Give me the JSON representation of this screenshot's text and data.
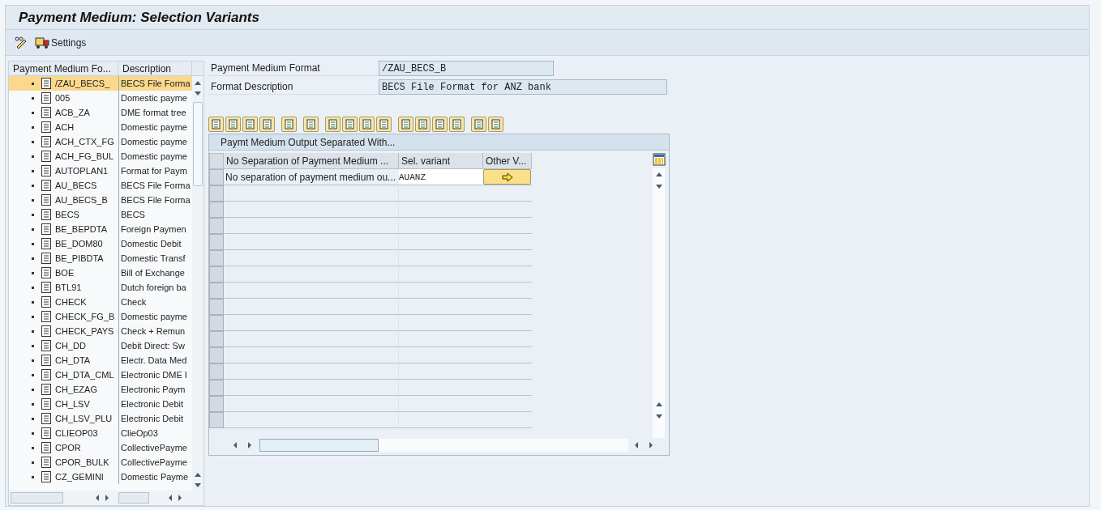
{
  "window": {
    "title": "Payment Medium: Selection Variants"
  },
  "toolbar": {
    "settings_label": "Settings"
  },
  "tree": {
    "columns": [
      "Payment Medium Fo...",
      "Description"
    ],
    "rows": [
      {
        "format": "/ZAU_BECS_",
        "description": "BECS File Forma",
        "selected": true
      },
      {
        "format": "005",
        "description": "Domestic payme",
        "selected": false
      },
      {
        "format": "ACB_ZA",
        "description": "DME format tree",
        "selected": false
      },
      {
        "format": "ACH",
        "description": "Domestic payme",
        "selected": false
      },
      {
        "format": "ACH_CTX_FG",
        "description": "Domestic payme",
        "selected": false
      },
      {
        "format": "ACH_FG_BUL",
        "description": "Domestic payme",
        "selected": false
      },
      {
        "format": "AUTOPLAN1",
        "description": "Format for Paym",
        "selected": false
      },
      {
        "format": "AU_BECS",
        "description": "BECS File Forma",
        "selected": false
      },
      {
        "format": "AU_BECS_B",
        "description": "BECS File Forma",
        "selected": false
      },
      {
        "format": "BECS",
        "description": "BECS",
        "selected": false
      },
      {
        "format": "BE_BEPDTA",
        "description": "Foreign Paymen",
        "selected": false
      },
      {
        "format": "BE_DOM80",
        "description": "Domestic Debit",
        "selected": false
      },
      {
        "format": "BE_PIBDTA",
        "description": "Domestic Transf",
        "selected": false
      },
      {
        "format": "BOE",
        "description": "Bill of Exchange",
        "selected": false
      },
      {
        "format": "BTL91",
        "description": "Dutch foreign ba",
        "selected": false
      },
      {
        "format": "CHECK",
        "description": "Check",
        "selected": false
      },
      {
        "format": "CHECK_FG_B",
        "description": "Domestic payme",
        "selected": false
      },
      {
        "format": "CHECK_PAYS",
        "description": "Check + Remun",
        "selected": false
      },
      {
        "format": "CH_DD",
        "description": "Debit Direct: Sw",
        "selected": false
      },
      {
        "format": "CH_DTA",
        "description": "Electr. Data Med",
        "selected": false
      },
      {
        "format": "CH_DTA_CML",
        "description": "Electronic DME I",
        "selected": false
      },
      {
        "format": "CH_EZAG",
        "description": "Electronic Paym",
        "selected": false
      },
      {
        "format": "CH_LSV",
        "description": "Electronic Debit",
        "selected": false
      },
      {
        "format": "CH_LSV_PLU",
        "description": "Electronic Debit",
        "selected": false
      },
      {
        "format": "CLIEOP03",
        "description": "ClieOp03",
        "selected": false
      },
      {
        "format": "CPOR",
        "description": "CollectivePayme",
        "selected": false
      },
      {
        "format": "CPOR_BULK",
        "description": "CollectivePayme",
        "selected": false
      },
      {
        "format": "CZ_GEMINI",
        "description": "Domestic Payme",
        "selected": false
      }
    ]
  },
  "fields": [
    {
      "label": "Payment Medium Format",
      "value": "/ZAU_BECS_B"
    },
    {
      "label": "Format Description",
      "value": "BECS File Format for ANZ bank"
    }
  ],
  "grid": {
    "title": "Paymt Medium Output Separated With...",
    "columns": [
      "No Separation of Payment Medium ...",
      "Sel. variant",
      "Other V..."
    ],
    "rows": [
      {
        "separation": "No separation of payment medium ou...",
        "variant": "AUANZ"
      }
    ]
  }
}
